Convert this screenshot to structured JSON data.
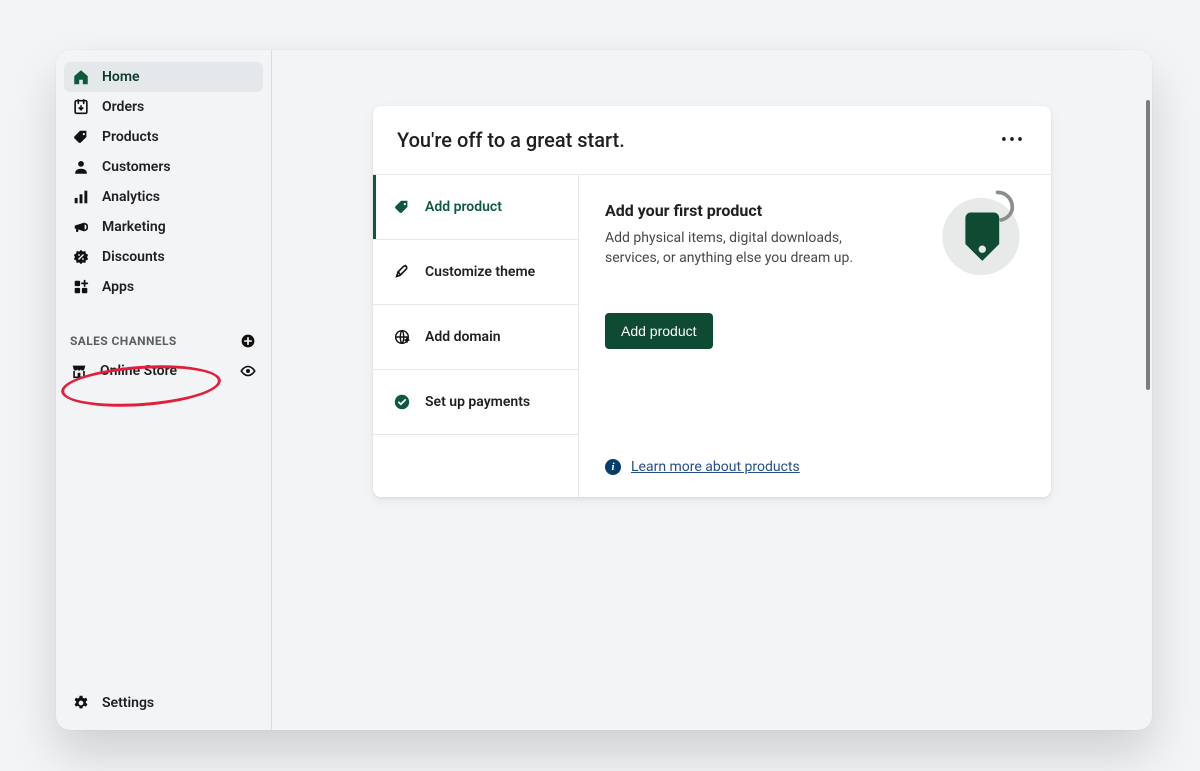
{
  "sidebar": {
    "nav": [
      {
        "key": "home",
        "label": "Home",
        "icon": "home-icon"
      },
      {
        "key": "orders",
        "label": "Orders",
        "icon": "orders-icon"
      },
      {
        "key": "products",
        "label": "Products",
        "icon": "tag-icon"
      },
      {
        "key": "customers",
        "label": "Customers",
        "icon": "person-icon"
      },
      {
        "key": "analytics",
        "label": "Analytics",
        "icon": "bars-icon"
      },
      {
        "key": "marketing",
        "label": "Marketing",
        "icon": "megaphone-icon"
      },
      {
        "key": "discounts",
        "label": "Discounts",
        "icon": "discount-icon"
      },
      {
        "key": "apps",
        "label": "Apps",
        "icon": "apps-icon"
      }
    ],
    "active_key": "home",
    "section_title": "SALES CHANNELS",
    "channel": {
      "label": "Online Store"
    },
    "settings_label": "Settings"
  },
  "card": {
    "title": "You're off to a great start.",
    "steps": [
      {
        "key": "add-product",
        "label": "Add product",
        "icon": "tag-icon-green",
        "active": true
      },
      {
        "key": "customize-theme",
        "label": "Customize theme",
        "icon": "brush-icon"
      },
      {
        "key": "add-domain",
        "label": "Add domain",
        "icon": "globe-icon"
      },
      {
        "key": "setup-payments",
        "label": "Set up payments",
        "icon": "check-circle-icon"
      }
    ],
    "detail": {
      "title": "Add your first product",
      "description": "Add physical items, digital downloads, services, or anything else you dream up.",
      "button_label": "Add product",
      "learn_more": "Learn more about products"
    }
  },
  "colors": {
    "accent": "#0f4a33",
    "link": "#254f8a",
    "highlight": "#e11f3c"
  }
}
